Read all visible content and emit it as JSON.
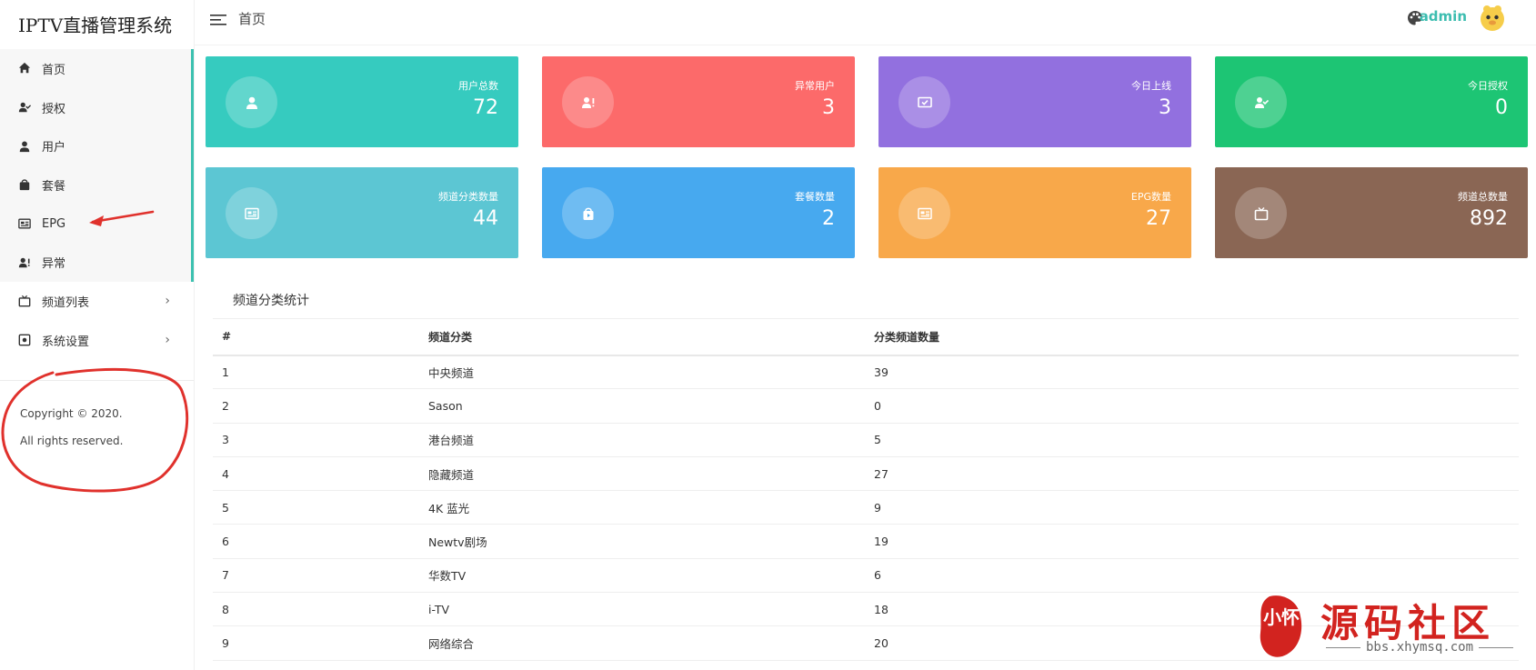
{
  "app": {
    "title": "IPTV直播管理系统"
  },
  "colors": {
    "accent": "#3cc1b0",
    "annotation": "#e0312c",
    "watermark": "#d2231f"
  },
  "sidebar": {
    "items": [
      {
        "label": "首页",
        "icon": "home-icon"
      },
      {
        "label": "授权",
        "icon": "user-check-icon"
      },
      {
        "label": "用户",
        "icon": "user-icon"
      },
      {
        "label": "套餐",
        "icon": "bag-icon"
      },
      {
        "label": "EPG",
        "icon": "epg-icon"
      },
      {
        "label": "异常",
        "icon": "user-alert-icon"
      },
      {
        "label": "频道列表",
        "icon": "tv-icon",
        "chevron": "›"
      },
      {
        "label": "系统设置",
        "icon": "settings-icon",
        "chevron": "›"
      }
    ],
    "copyright_line1": "Copyright © 2020.",
    "copyright_line2": "All rights reserved."
  },
  "topbar": {
    "page_title": "首页",
    "username": "admin"
  },
  "stats": [
    {
      "label": "用户总数",
      "value": "72",
      "color": "#36cbbf",
      "icon": "user-icon"
    },
    {
      "label": "异常用户",
      "value": "3",
      "color": "#fc6a6a",
      "icon": "user-alert-icon"
    },
    {
      "label": "今日上线",
      "value": "3",
      "color": "#9270df",
      "icon": "screen-check-icon"
    },
    {
      "label": "今日授权",
      "value": "0",
      "color": "#1dc574",
      "icon": "user-check-icon"
    },
    {
      "label": "频道分类数量",
      "value": "44",
      "color": "#5cc6d3",
      "icon": "epg-icon"
    },
    {
      "label": "套餐数量",
      "value": "2",
      "color": "#47a9ef",
      "icon": "bag-icon"
    },
    {
      "label": "EPG数量",
      "value": "27",
      "color": "#f8a84a",
      "icon": "epg-icon"
    },
    {
      "label": "频道总数量",
      "value": "892",
      "color": "#8a6654",
      "icon": "tv-icon"
    }
  ],
  "table": {
    "title": "频道分类统计",
    "headers": [
      "#",
      "频道分类",
      "",
      "分类频道数量"
    ],
    "rows": [
      [
        "1",
        "中央频道",
        "39"
      ],
      [
        "2",
        "Sason",
        "0"
      ],
      [
        "3",
        "港台频道",
        "5"
      ],
      [
        "4",
        "隐藏频道",
        "27"
      ],
      [
        "5",
        "4K 蓝光",
        "9"
      ],
      [
        "6",
        "Newtv剧场",
        "19"
      ],
      [
        "7",
        "华数TV",
        "6"
      ],
      [
        "8",
        "i-TV",
        "18"
      ],
      [
        "9",
        "网络综合",
        "20"
      ]
    ]
  },
  "watermark": {
    "text": "源码社区",
    "url": "bbs.xhymsq.com",
    "seal": "小怀"
  }
}
